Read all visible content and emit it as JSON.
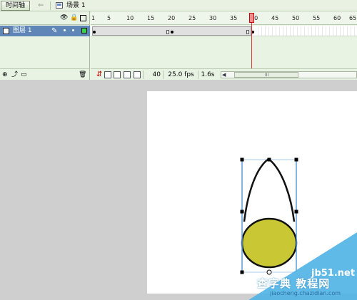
{
  "toolbar": {
    "timeline_label": "时间轴",
    "scene_label": "场景 1"
  },
  "layers": [
    {
      "label": "图层 1",
      "color": "#35d64b"
    }
  ],
  "ruler": {
    "ticks": [
      "1",
      "5",
      "10",
      "15",
      "20",
      "25",
      "30",
      "35",
      "40",
      "45",
      "50",
      "55",
      "60",
      "65"
    ]
  },
  "timeline": {
    "current_frame": "40",
    "frame_rate": "25.0 fps",
    "elapsed_time": "1.6s",
    "scroll_grip": "III"
  },
  "colors": {
    "ball_fill": "#c9c834",
    "selection_outline": "#5b9bd5",
    "layer_selected": "#5f86b6",
    "playhead": "#e33333"
  },
  "watermark": {
    "domain": "jb51.net",
    "site_name": "查字典 教程网",
    "url": "jiaocheng.chazidian.com"
  }
}
